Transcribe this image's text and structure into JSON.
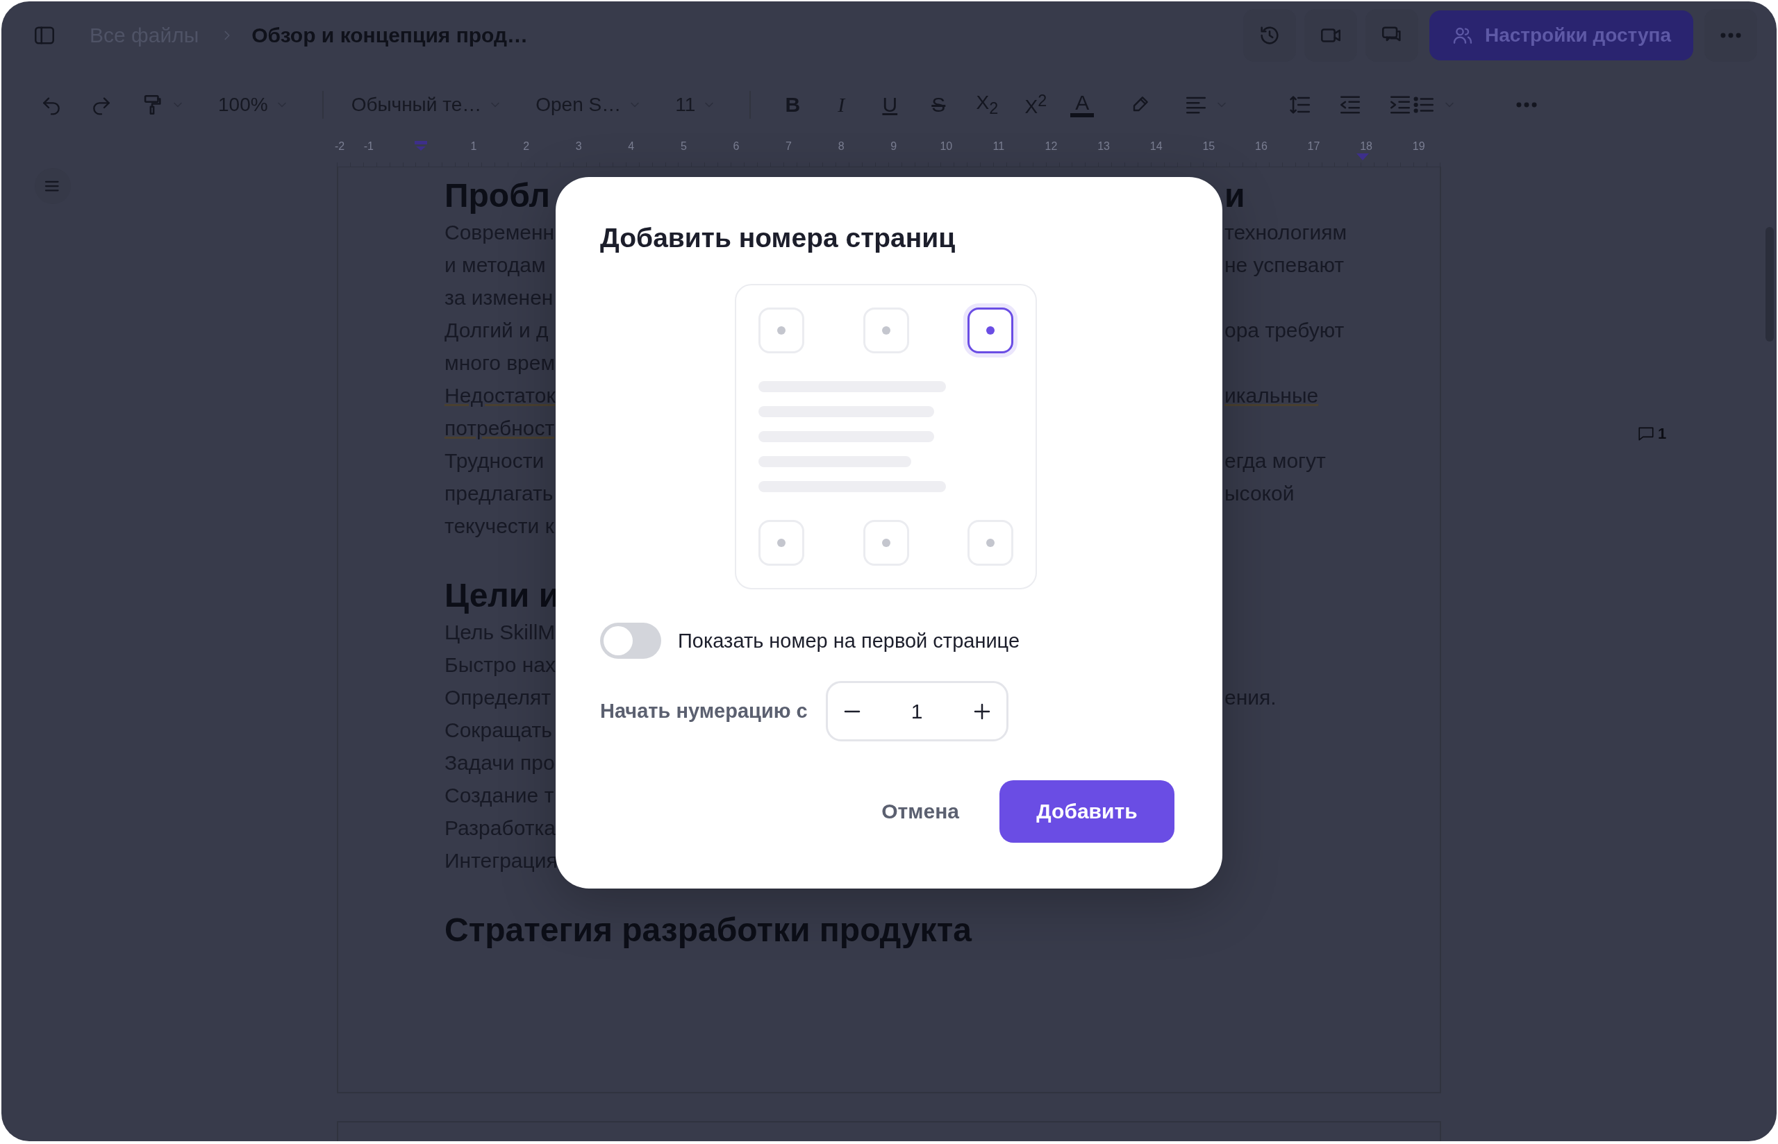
{
  "topbar": {
    "breadcrumb": "Все файлы",
    "title": "Обзор и концепция прод…",
    "share_button": "Настройки доступа"
  },
  "toolbar": {
    "zoom": "100%",
    "style": "Обычный те…",
    "font": "Open S…",
    "size": "11",
    "format": [
      {
        "label": "B",
        "kind": "bold"
      },
      {
        "label": "I",
        "kind": "italic"
      },
      {
        "label": "U",
        "kind": "underline"
      },
      {
        "label": "S",
        "kind": "strike"
      },
      {
        "label": "X$_{2}$",
        "kind": "script"
      },
      {
        "label": "X$^{2}$",
        "kind": "script"
      }
    ],
    "text_color": "A"
  },
  "ruler": {
    "labels": [
      "-2",
      "-1",
      "1",
      "2",
      "3",
      "4",
      "5",
      "6",
      "7",
      "8",
      "9",
      "10",
      "11",
      "12",
      "13",
      "14",
      "15",
      "16",
      "17",
      "18",
      "19"
    ]
  },
  "document": {
    "blocks": [
      {
        "kind": "heading",
        "left": "Пробл",
        "right": "и"
      },
      {
        "kind": "line",
        "left": "Современн",
        "right": "технологиям"
      },
      {
        "kind": "line",
        "left": "и методам",
        "right": "не успевают"
      },
      {
        "kind": "line",
        "left": "за изменен"
      },
      {
        "kind": "line",
        "left": "Долгий и д",
        "right": "ора требуют"
      },
      {
        "kind": "line",
        "left": "много врем"
      },
      {
        "kind": "line",
        "left": "Недостаток",
        "right": "икальные",
        "underline": true
      },
      {
        "kind": "line",
        "left": "потребност",
        "underline": true
      },
      {
        "kind": "line",
        "left": "Трудности",
        "right": "егда могут"
      },
      {
        "kind": "line",
        "left": "предлагать",
        "right": "ысокой"
      },
      {
        "kind": "line",
        "left": "текучести к"
      },
      {
        "kind": "heading",
        "left": "Цели и"
      },
      {
        "kind": "line",
        "left": "Цель SkillM"
      },
      {
        "kind": "line",
        "left": "Быстро нах"
      },
      {
        "kind": "line",
        "left": "Определят",
        "right": "ения."
      },
      {
        "kind": "line",
        "left": "Сокращать"
      },
      {
        "kind": "line",
        "left": "Задачи про"
      },
      {
        "kind": "line",
        "left": "Создание т"
      },
      {
        "kind": "line",
        "left": "Разработка"
      },
      {
        "kind": "line",
        "left": "Интеграция"
      },
      {
        "kind": "heading",
        "left": "Стратегия разработки продукта"
      }
    ]
  },
  "comments": {
    "count": "1"
  },
  "dialog": {
    "title": "Добавить номера страниц",
    "positions": [
      {
        "selected": false
      },
      {
        "selected": false
      },
      {
        "selected": true
      },
      {
        "selected": false
      },
      {
        "selected": false
      },
      {
        "selected": false
      }
    ],
    "first_page": {
      "label": "Показать номер на первой странице",
      "on": false
    },
    "start": {
      "label": "Начать нумерацию с",
      "value": "1"
    },
    "cancel": "Отмена",
    "confirm": "Добавить"
  }
}
